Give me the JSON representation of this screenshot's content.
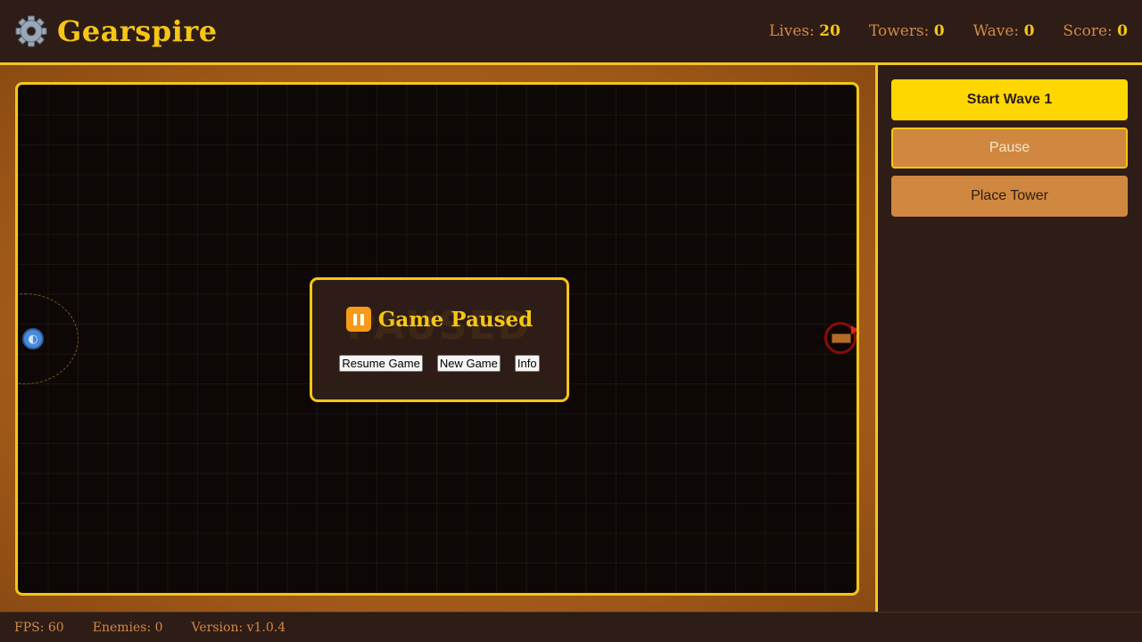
{
  "app": {
    "title": "Gearspire",
    "logo_icon": "gear-icon"
  },
  "header": {
    "stats": [
      {
        "label": "Lives:",
        "value": "20"
      },
      {
        "label": "Towers:",
        "value": "0"
      },
      {
        "label": "Wave:",
        "value": "0"
      },
      {
        "label": "Score:",
        "value": "0"
      }
    ]
  },
  "modal": {
    "watermark": "PAUSED",
    "icon": "pause-icon",
    "title": "Game Paused",
    "buttons": {
      "resume": "Resume Game",
      "new_game": "New Game",
      "info": "Info"
    }
  },
  "sidebar": {
    "start_wave": "Start Wave 1",
    "pause": "Pause",
    "place_tower": "Place Tower"
  },
  "footer": {
    "fps": "FPS: 60",
    "enemies": "Enemies: 0",
    "version": "Version: v1.0.4"
  },
  "colors": {
    "accent": "#f5c518",
    "background": "#2e1c16",
    "button_orange": "#d08840",
    "board": "#0d0806"
  }
}
